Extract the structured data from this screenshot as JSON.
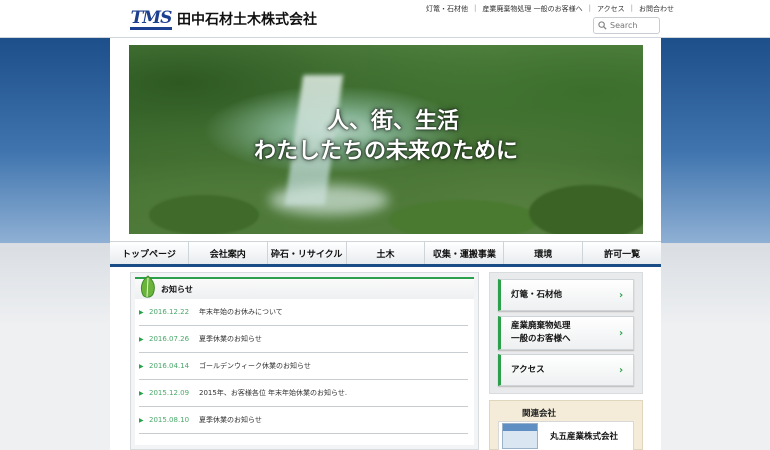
{
  "header": {
    "logo_mark": "TMS",
    "company_name": "田中石材土木株式会社",
    "top_links": [
      "灯篭・石材他",
      "産業廃棄物処理 一般のお客様へ",
      "アクセス",
      "お問合わせ"
    ],
    "search_placeholder": "Search"
  },
  "hero": {
    "line1": "人、街、生活",
    "line2": "わたしたちの未来のために"
  },
  "nav": {
    "items": [
      "トップページ",
      "会社案内",
      "砕石・リサイクル",
      "土木",
      "収集・運搬事業",
      "環境",
      "許可一覧"
    ]
  },
  "news": {
    "heading": "お知らせ",
    "items": [
      {
        "date": "2016.12.22",
        "title": "年末年始のお休みについて"
      },
      {
        "date": "2016.07.26",
        "title": "夏季休業のお知らせ"
      },
      {
        "date": "2016.04.14",
        "title": "ゴールデンウィーク休業のお知らせ"
      },
      {
        "date": "2015.12.09",
        "title": "2015年、お客様各位 年末年始休業のお知らせ."
      },
      {
        "date": "2015.08.10",
        "title": "夏季休業のお知らせ"
      }
    ]
  },
  "side": {
    "buttons": [
      {
        "line1": "灯篭・石材他",
        "line2": ""
      },
      {
        "line1": "産業廃棄物処理",
        "line2": "一般のお客様へ"
      },
      {
        "line1": "アクセス",
        "line2": ""
      }
    ],
    "related_title": "関連会社",
    "related_company": "丸五産業株式会社"
  },
  "colors": {
    "accent_green": "#2aa04a",
    "brand_blue": "#1a4d86"
  }
}
